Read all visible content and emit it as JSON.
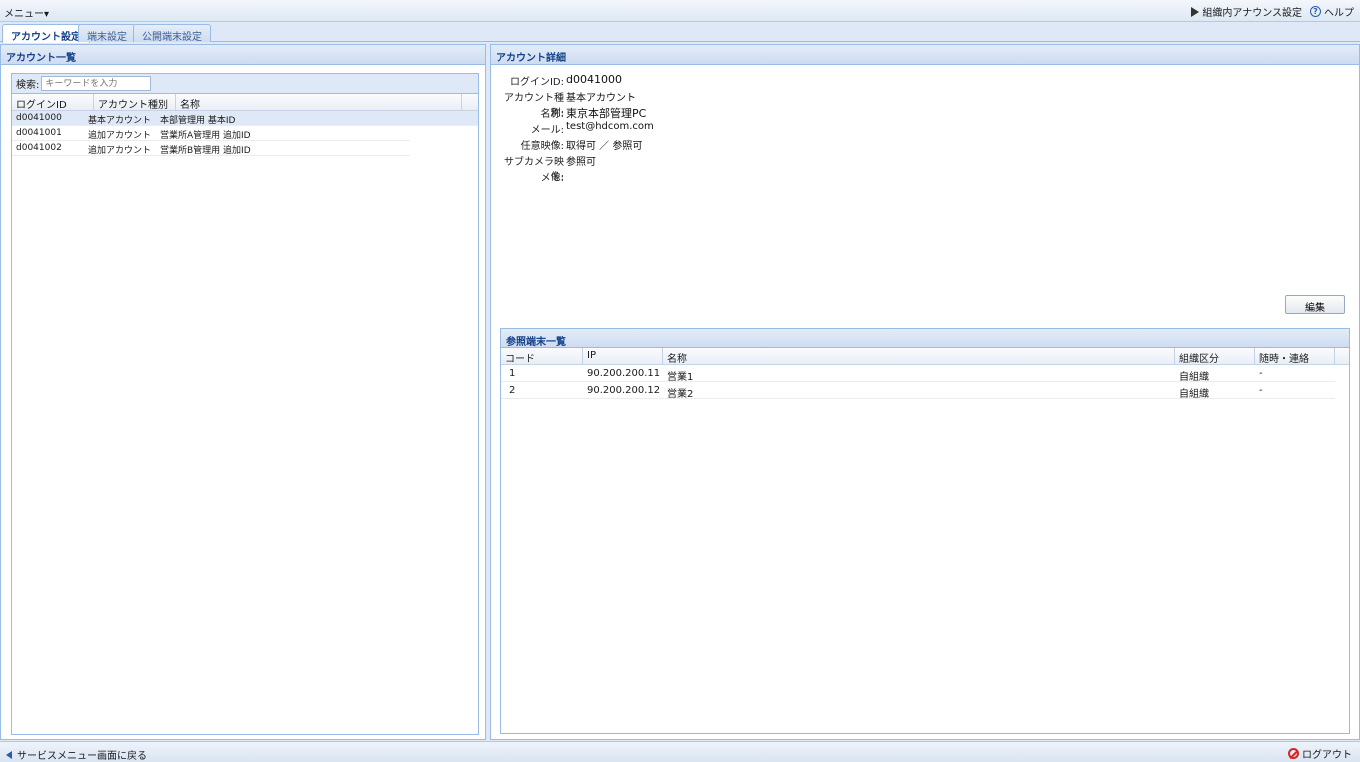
{
  "topbar": {
    "menu_label": "メニュー▾",
    "announce_label": "組織内アナウンス設定",
    "help_label": "ヘルプ"
  },
  "tabs": [
    {
      "label": "アカウント設定",
      "active": true
    },
    {
      "label": "端末設定",
      "active": false
    },
    {
      "label": "公開端末設定",
      "active": false
    }
  ],
  "left_panel": {
    "title": "アカウント一覧",
    "search_label": "検索:",
    "search_placeholder": "キーワードを入力",
    "columns": [
      "ログインID",
      "アカウント種別",
      "名称"
    ],
    "rows": [
      {
        "id": "d0041000",
        "type": "基本アカウント",
        "name": "本部管理用 基本ID"
      },
      {
        "id": "d0041001",
        "type": "追加アカウント",
        "name": "営業所A管理用 追加ID"
      },
      {
        "id": "d0041002",
        "type": "追加アカウント",
        "name": "営業所B管理用 追加ID"
      }
    ]
  },
  "right_panel": {
    "title": "アカウント詳細",
    "details": [
      {
        "label": "ログインID:",
        "value": "d0041000"
      },
      {
        "label": "アカウント種別:",
        "value": "基本アカウント"
      },
      {
        "label": "名称:",
        "value": "東京本部管理PC"
      },
      {
        "label": "メール:",
        "value": "test@hdcom.com"
      },
      {
        "label": "任意映像:",
        "value": "取得可 ／ 参照可"
      },
      {
        "label": "サブカメラ映像:",
        "value": "参照可"
      },
      {
        "label": "メモ:",
        "value": ""
      }
    ],
    "edit_label": "編集",
    "terminal_list": {
      "title": "参照端末一覧",
      "columns": [
        "コード",
        "IP",
        "名称",
        "組織区分",
        "随時・連絡"
      ],
      "rows": [
        {
          "code": "1",
          "ip": "90.200.200.11",
          "name": "営業1",
          "org": "自組織",
          "contact": "-"
        },
        {
          "code": "2",
          "ip": "90.200.200.12",
          "name": "営業2",
          "org": "自組織",
          "contact": "-"
        }
      ]
    }
  },
  "bottombar": {
    "back_label": "サービスメニュー画面に戻る",
    "logout_label": "ログアウト"
  }
}
